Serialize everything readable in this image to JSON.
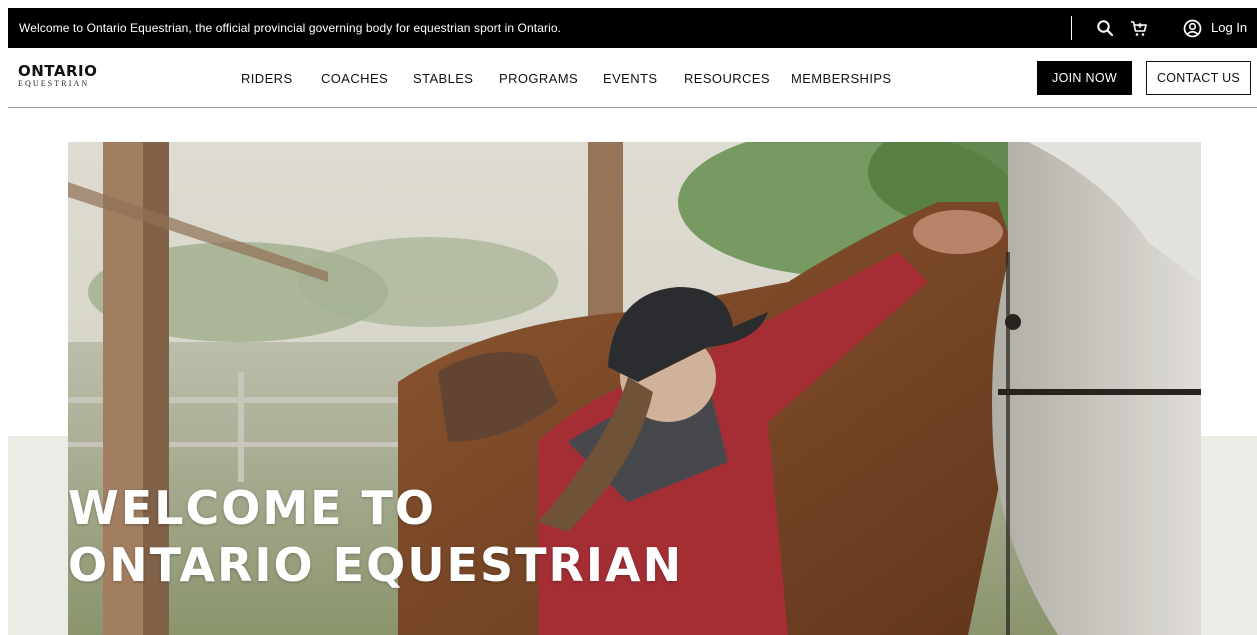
{
  "topbar": {
    "welcome_text": "Welcome to Ontario Equestrian, the official provincial governing body for equestrian sport in Ontario.",
    "search_icon": "search-icon",
    "cart_icon": "cart-icon",
    "user_icon": "user-circle-icon",
    "login_label": "Log In"
  },
  "logo": {
    "line1": "ONTARIO",
    "line2": "EQUESTRIAN"
  },
  "nav": {
    "items": [
      {
        "label": "RIDERS"
      },
      {
        "label": "COACHES"
      },
      {
        "label": "STABLES"
      },
      {
        "label": "PROGRAMS"
      },
      {
        "label": "EVENTS"
      },
      {
        "label": "RESOURCES"
      },
      {
        "label": "MEMBERSHIPS"
      }
    ],
    "join_label": "JOIN NOW",
    "contact_label": "CONTACT US"
  },
  "hero": {
    "title_line1": "WELCOME TO",
    "title_line2": "ONTARIO EQUESTRIAN"
  },
  "colors": {
    "topbar_bg": "#000000",
    "hero_band": "#ecece7",
    "rider_jacket": "#b3323a"
  }
}
